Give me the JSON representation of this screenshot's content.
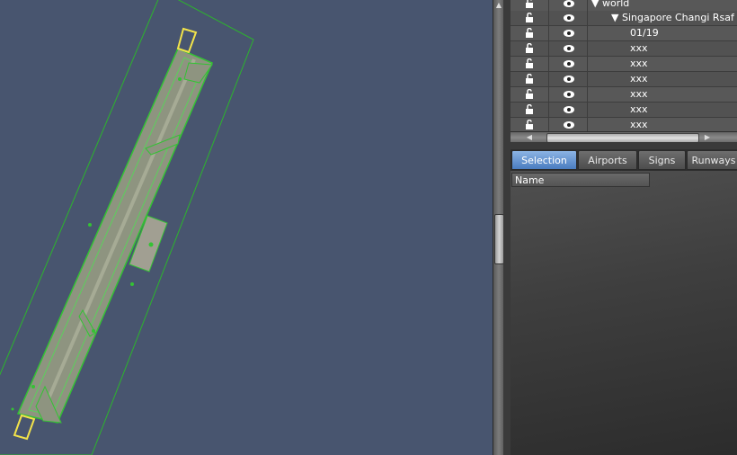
{
  "tree": {
    "rows": [
      {
        "label": "world",
        "expander": "▼"
      },
      {
        "label": "Singapore Changi Rsaf",
        "expander": "▼"
      },
      {
        "label": "01/19"
      },
      {
        "label": "xxx"
      },
      {
        "label": "xxx"
      },
      {
        "label": "xxx"
      },
      {
        "label": "xxx"
      },
      {
        "label": "xxx"
      },
      {
        "label": "xxx"
      }
    ]
  },
  "tabs": [
    {
      "label": "Selection",
      "active": true
    },
    {
      "label": "Airports",
      "active": false
    },
    {
      "label": "Signs",
      "active": false
    },
    {
      "label": "Runways",
      "active": false
    }
  ],
  "panel": {
    "column_header": "Name"
  },
  "icons": {
    "lock": "unlock-icon",
    "visibility": "eye-icon",
    "scroll_left": "arrow-left-icon",
    "scroll_right": "arrow-right-icon"
  },
  "colors": {
    "map_background": "#48556f",
    "selection_green": "#2fbf2f",
    "runway_gray": "#9a9e8a",
    "highlight_yellow": "#f2e34a",
    "tab_active": "#5b8ed3"
  }
}
